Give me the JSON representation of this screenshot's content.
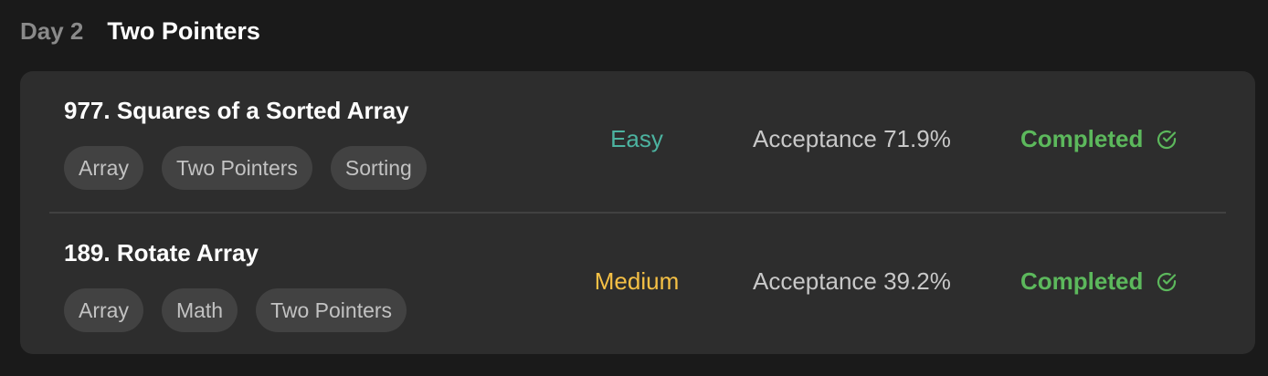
{
  "header": {
    "day": "Day 2",
    "title": "Two Pointers"
  },
  "colors": {
    "background": "#1a1a1a",
    "card": "#2d2d2d",
    "tag_bg": "#424242",
    "easy": "#4cb3a0",
    "medium": "#f5c045",
    "completed": "#5cb85c"
  },
  "problems": [
    {
      "title": "977. Squares of a Sorted Array",
      "tags": [
        "Array",
        "Two Pointers",
        "Sorting"
      ],
      "difficulty": "Easy",
      "difficulty_color": "#4cb3a0",
      "acceptance": "Acceptance 71.9%",
      "status": "Completed",
      "status_icon": "check-circle-icon"
    },
    {
      "title": "189. Rotate Array",
      "tags": [
        "Array",
        "Math",
        "Two Pointers"
      ],
      "difficulty": "Medium",
      "difficulty_color": "#f5c045",
      "acceptance": "Acceptance 39.2%",
      "status": "Completed",
      "status_icon": "check-circle-icon"
    }
  ]
}
